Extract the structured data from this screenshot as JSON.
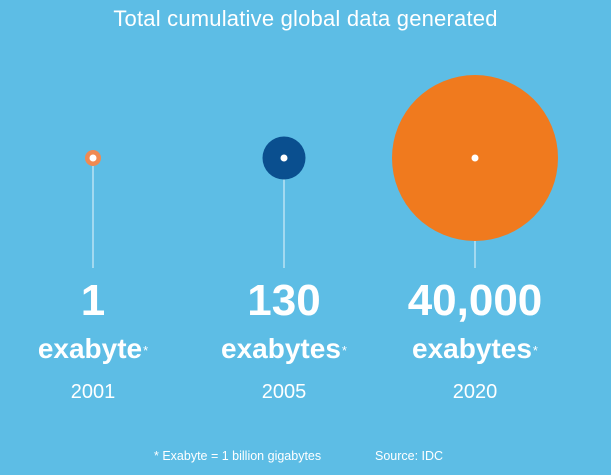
{
  "title": "Total cumulative global data generated",
  "footnote": "* Exabyte = 1 billion gigabytes",
  "source": "Source: IDC",
  "colors": {
    "background": "#5dbde5",
    "bubble_2001": "#f08a52",
    "bubble_2005": "#0a4f8f",
    "bubble_2020": "#f07a1e"
  },
  "chart_data": {
    "type": "bubble",
    "title": "Total cumulative global data generated",
    "categories": [
      "2001",
      "2005",
      "2020"
    ],
    "values": [
      1,
      130,
      40000
    ],
    "points": [
      {
        "year": "2001",
        "value": 1,
        "value_label": "1",
        "unit": "exabyte",
        "marker": "*"
      },
      {
        "year": "2005",
        "value": 130,
        "value_label": "130",
        "unit": "exabytes",
        "marker": "*"
      },
      {
        "year": "2020",
        "value": 40000,
        "value_label": "40,000",
        "unit": "exabytes",
        "marker": "*"
      }
    ],
    "grid": false
  }
}
